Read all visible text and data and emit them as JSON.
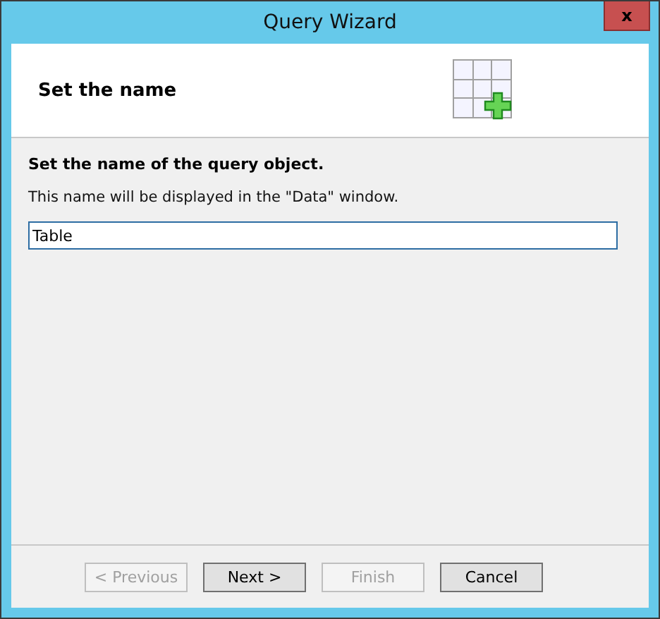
{
  "window": {
    "title": "Query Wizard",
    "close": "x"
  },
  "header": {
    "title": "Set the name"
  },
  "body": {
    "heading": "Set the name of the query object.",
    "description": "This name will be displayed in the \"Data\" window.",
    "name_field": {
      "value": "Table"
    }
  },
  "buttons": [
    {
      "label": "< Previous",
      "disabled": true
    },
    {
      "label": "Next >",
      "disabled": false
    },
    {
      "label": "Finish",
      "disabled": true
    },
    {
      "label": "Cancel",
      "disabled": false
    }
  ]
}
